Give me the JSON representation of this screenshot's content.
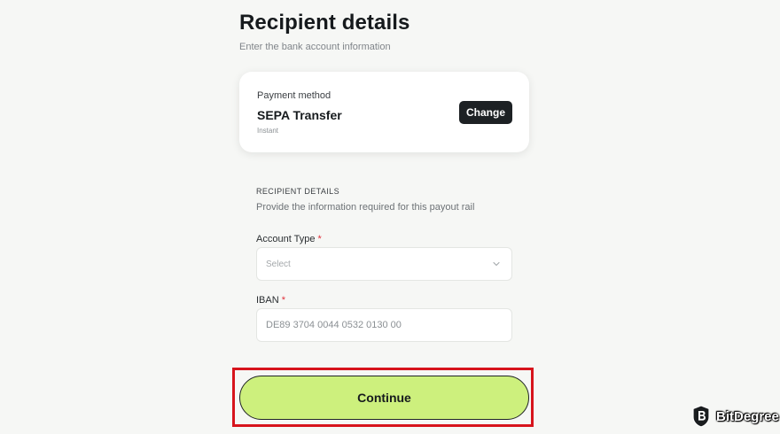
{
  "header": {
    "title": "Recipient details",
    "subtitle": "Enter the bank account information"
  },
  "payment_method": {
    "label": "Payment method",
    "name": "SEPA Transfer",
    "speed": "Instant",
    "change_label": "Change"
  },
  "recipient_section": {
    "heading": "RECIPIENT DETAILS",
    "description": "Provide the information required for this payout rail"
  },
  "form": {
    "account_type": {
      "label": "Account Type",
      "required_mark": "*",
      "value": "Select"
    },
    "iban": {
      "label": "IBAN",
      "required_mark": "*",
      "placeholder": "DE89 3704 0044 0532 0130 00"
    }
  },
  "actions": {
    "continue_label": "Continue"
  },
  "watermark": {
    "text": "BitDegree"
  },
  "colors": {
    "accent": "#cdf07d",
    "highlight": "#d7141c",
    "dark_button": "#1d2124"
  }
}
